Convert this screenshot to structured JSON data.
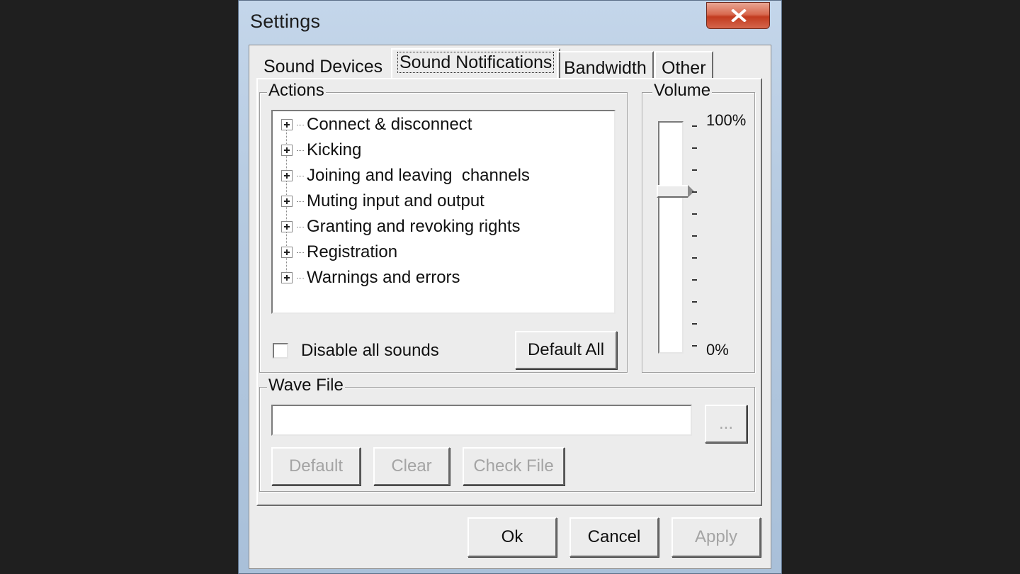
{
  "window": {
    "title": "Settings"
  },
  "tabs": [
    {
      "label": "Sound Devices"
    },
    {
      "label": "Sound Notifications"
    },
    {
      "label": "Bandwidth"
    },
    {
      "label": "Other"
    }
  ],
  "active_tab": "Sound Notifications",
  "actions": {
    "title": "Actions",
    "items": [
      {
        "label": "Connect & disconnect"
      },
      {
        "label": "Kicking"
      },
      {
        "label": "Joining and leaving  channels"
      },
      {
        "label": "Muting input and output"
      },
      {
        "label": "Granting and revoking rights"
      },
      {
        "label": "Registration"
      },
      {
        "label": "Warnings and errors"
      }
    ],
    "disable_all_label": "Disable all sounds",
    "disable_all_checked": false,
    "default_all_label": "Default All"
  },
  "volume": {
    "title": "Volume",
    "max_label": "100%",
    "min_label": "0%",
    "level_fraction": 0.7
  },
  "wave_file": {
    "title": "Wave File",
    "value": "",
    "browse_label": "...",
    "default_label": "Default",
    "clear_label": "Clear",
    "check_file_label": "Check File"
  },
  "footer": {
    "ok_label": "Ok",
    "cancel_label": "Cancel",
    "apply_label": "Apply"
  }
}
